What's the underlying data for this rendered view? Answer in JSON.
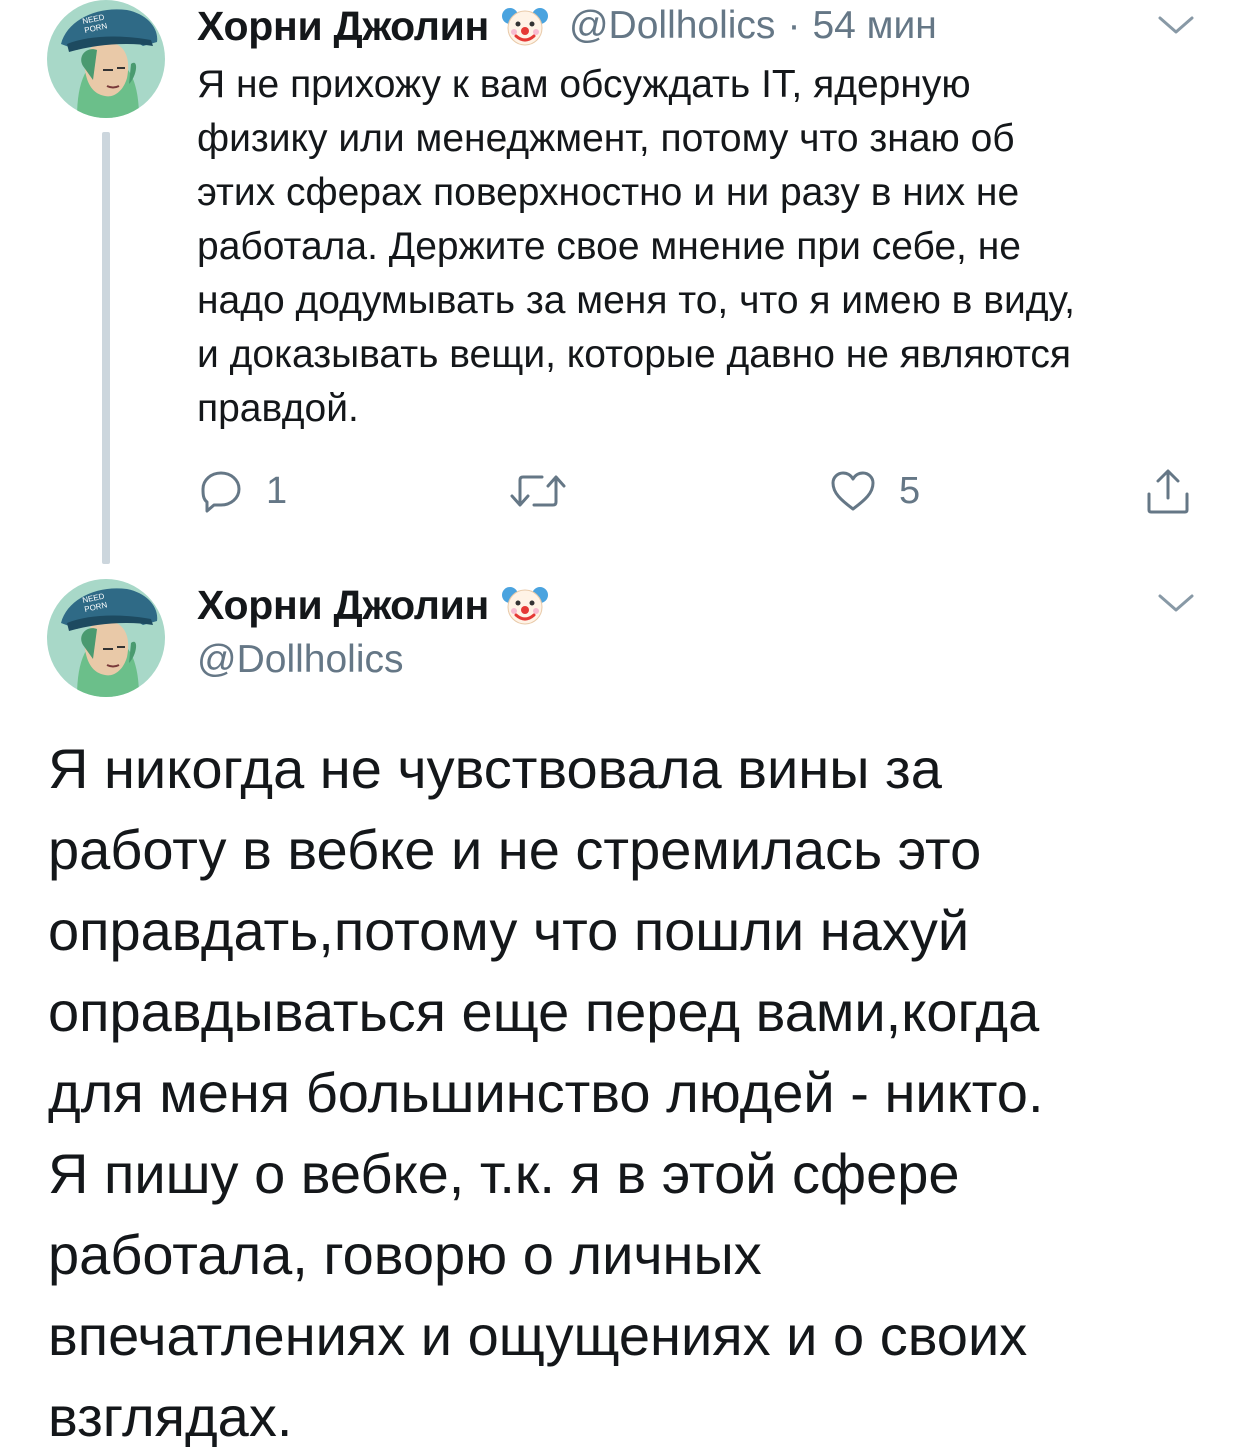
{
  "tweet1": {
    "display_name": "Хорни Джолин",
    "handle": "@Dollholics",
    "separator": "·",
    "time": "54 мин",
    "text_lines": [
      "Я не прихожу к вам обсуждать IT,  ядерную",
      "физику или менеджмент,  потому что знаю об",
      "этих сферах поверхностно и ни разу в них не",
      "работала. Держите свое мнение при себе, не",
      "надо додумывать за меня то, что я имею в виду,",
      "и доказывать вещи, которые давно не являются",
      "правдой."
    ],
    "actions": {
      "reply_count": "1",
      "retweet_count": "",
      "like_count": "5"
    },
    "icons": [
      "reply-icon",
      "retweet-icon",
      "like-icon",
      "share-icon",
      "chevron-down-icon",
      "clown-emoji-icon"
    ]
  },
  "tweet2": {
    "display_name": "Хорни Джолин",
    "handle": "@Dollholics",
    "text_lines": [
      "Я никогда не чувствовала вины за",
      "работу в вебке и не стремилась это",
      "оправдать,потому что пошли нахуй",
      "оправдываться еще перед вами,когда",
      "для меня большинство людей - никто.",
      "Я пишу о вебке, т.к. я в этой сфере",
      "работала, говорю о личных",
      "впечатлениях и ощущениях и о своих",
      "взглядах."
    ]
  },
  "avatar": {
    "cap_text_line1": "NEED",
    "cap_text_line2": "PORN"
  },
  "colors": {
    "text": "#14171a",
    "secondary": "#657786",
    "thread_line": "#ccd6dd",
    "icon": "#657786"
  }
}
